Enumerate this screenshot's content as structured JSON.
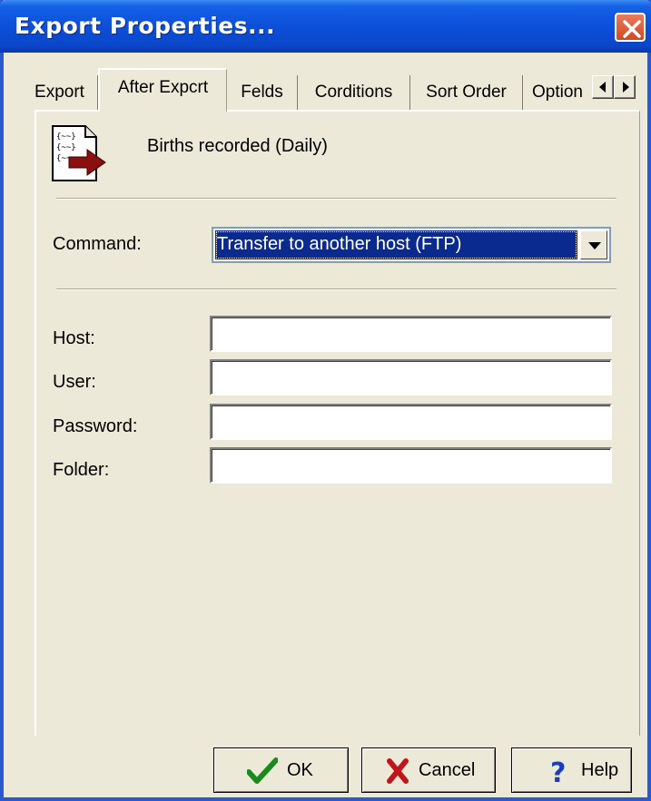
{
  "window": {
    "title": "Export Properties...",
    "close_icon": "close-icon"
  },
  "tabs": [
    {
      "label": "Export",
      "selected": false
    },
    {
      "label": "After Expcrt",
      "selected": true
    },
    {
      "label": "Felds",
      "selected": false
    },
    {
      "label": "Corditions",
      "selected": false
    },
    {
      "label": "Sort Order",
      "selected": false
    },
    {
      "label": "Option",
      "selected": false
    }
  ],
  "report": {
    "name": "Births recorded (Daily)",
    "icon": "export-document-icon"
  },
  "command": {
    "label": "Command:",
    "value": "Transfer to another host (FTP)"
  },
  "fields": {
    "host_label": "Host:",
    "host_value": "",
    "user_label": "User:",
    "user_value": "",
    "password_label": "Password:",
    "password_value": "",
    "folder_label": "Folder:",
    "folder_value": ""
  },
  "buttons": {
    "ok": "OK",
    "cancel": "Cancel",
    "help": "Help"
  },
  "colors": {
    "titlebar": "#0c4fd9",
    "dialog_bg": "#ece9d8",
    "selection": "#0b2a8f",
    "ok_check": "#1a8a1a",
    "cancel_x": "#c0161b",
    "help_q": "#1c3fb8"
  }
}
